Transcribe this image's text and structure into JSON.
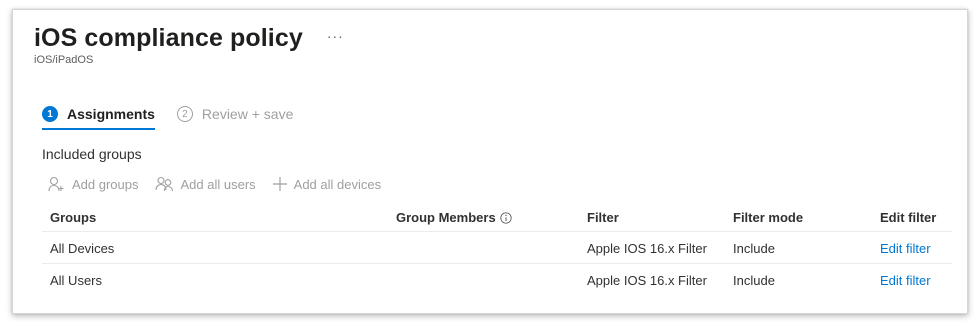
{
  "header": {
    "title": "iOS compliance policy",
    "more_label": "···",
    "subtitle": "iOS/iPadOS"
  },
  "steps": [
    {
      "number": "1",
      "label": "Assignments",
      "active": true
    },
    {
      "number": "2",
      "label": "Review + save",
      "active": false
    }
  ],
  "included_groups": {
    "title": "Included groups",
    "toolbar": {
      "add_groups": "Add groups",
      "add_all_users": "Add all users",
      "add_all_devices": "Add all devices"
    }
  },
  "table": {
    "columns": [
      "Groups",
      "Group Members",
      "Filter",
      "Filter mode",
      "Edit filter"
    ],
    "rows": [
      {
        "group": "All Devices",
        "members": "",
        "filter": "Apple IOS 16.x Filter",
        "mode": "Include",
        "edit": "Edit filter"
      },
      {
        "group": "All Users",
        "members": "",
        "filter": "Apple IOS 16.x Filter",
        "mode": "Include",
        "edit": "Edit filter"
      }
    ]
  },
  "colors": {
    "accent": "#0078d4",
    "disabled": "#a19f9d",
    "text": "#323130"
  }
}
